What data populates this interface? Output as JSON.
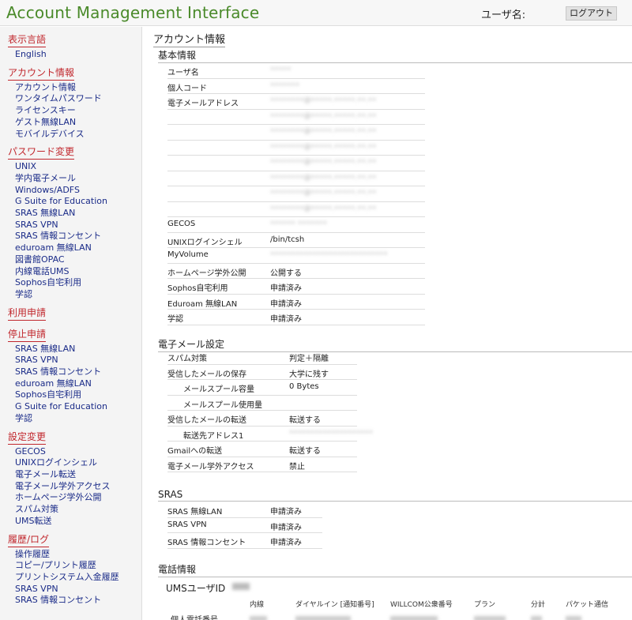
{
  "header": {
    "title": "Account Management Interface",
    "user_label": "ユーザ名:",
    "logout_label": "ログアウト"
  },
  "sidebar": {
    "sections": [
      {
        "heading": "表示言語",
        "items": [
          "English"
        ]
      },
      {
        "heading": "アカウント情報",
        "items": [
          "アカウント情報",
          "ワンタイムパスワード",
          "ライセンスキー",
          "ゲスト無線LAN",
          "モバイルデバイス"
        ]
      },
      {
        "heading": "パスワード変更",
        "items": [
          "UNIX",
          "学内電子メール",
          "Windows/ADFS",
          "G Suite for Education",
          "SRAS 無線LAN",
          "SRAS VPN",
          "SRAS 情報コンセント",
          "eduroam 無線LAN",
          "図書館OPAC",
          "内線電話UMS",
          "Sophos自宅利用",
          "学認"
        ]
      },
      {
        "heading": "利用申請",
        "items": []
      },
      {
        "heading": "停止申請",
        "items": [
          "SRAS 無線LAN",
          "SRAS VPN",
          "SRAS 情報コンセント",
          "eduroam 無線LAN",
          "Sophos自宅利用",
          "G Suite for Education",
          "学認"
        ]
      },
      {
        "heading": "設定変更",
        "items": [
          "GECOS",
          "UNIXログインシェル",
          "電子メール転送",
          "電子メール学外アクセス",
          "ホームページ学外公開",
          "スパム対策",
          "UMS転送"
        ]
      },
      {
        "heading": "履歴/ログ",
        "items": [
          "操作履歴",
          "コピー/プリント履歴",
          "プリントシステム入金履歴",
          "SRAS VPN",
          "SRAS 情報コンセント"
        ]
      }
    ]
  },
  "main": {
    "page_title": "アカウント情報",
    "basic": {
      "heading": "基本情報",
      "rows": [
        {
          "label": "ユーザ名",
          "value": "",
          "blur": "•••••"
        },
        {
          "label": "個人コード",
          "value": "",
          "blur": "•••••••"
        },
        {
          "label": "電子メールアドレス",
          "value": "",
          "blur": "••••••••@•••••.•••••.••.••"
        },
        {
          "label": "",
          "value": "",
          "blur": "••••••••@•••••.•••••.••.••"
        },
        {
          "label": "",
          "value": "",
          "blur": "••••••••@•••••.•••••.••.••"
        },
        {
          "label": "",
          "value": "",
          "blur": "••••••••@•••••.•••••.••.••"
        },
        {
          "label": "",
          "value": "",
          "blur": "••••••••@•••••.•••••.••.••"
        },
        {
          "label": "",
          "value": "",
          "blur": "••••••••@•••••.•••••.••.••"
        },
        {
          "label": "",
          "value": "",
          "blur": "••••••••@•••••.•••••.••.••"
        },
        {
          "label": "",
          "value": "",
          "blur": "••••••••@•••••.•••••.••.••"
        },
        {
          "label": "GECOS",
          "value": "",
          "blur": "•••••• •••••••"
        },
        {
          "label": "UNIXログインシェル",
          "value": "/bin/tcsh",
          "blur": ""
        },
        {
          "label": "MyVolume",
          "value": "",
          "blur": "••••••••••••••••••••••••••••"
        },
        {
          "label": "ホームページ学外公開",
          "value": "公開する",
          "blur": ""
        },
        {
          "label": "Sophos自宅利用",
          "value": "申請済み",
          "blur": ""
        },
        {
          "label": "Eduroam 無線LAN",
          "value": "申請済み",
          "blur": ""
        },
        {
          "label": "学認",
          "value": "申請済み",
          "blur": ""
        }
      ]
    },
    "email": {
      "heading": "電子メール設定",
      "rows": [
        {
          "label": "スパム対策",
          "value": "判定＋隔離",
          "indent": 0
        },
        {
          "label": "受信したメールの保存",
          "value": "大学に残す",
          "indent": 0
        },
        {
          "label": "メールスプール容量",
          "value": "0 Bytes",
          "indent": 1
        },
        {
          "label": "メールスプール使用量",
          "value": "",
          "indent": 1
        },
        {
          "label": "受信したメールの転送",
          "value": "転送する",
          "indent": 0
        },
        {
          "label": "転送先アドレス1",
          "value": "",
          "indent": 1,
          "blur": "••••••••••••••••••••"
        },
        {
          "label": "Gmailへの転送",
          "value": "転送する",
          "indent": 0
        },
        {
          "label": "電子メール学外アクセス",
          "value": "禁止",
          "indent": 0
        }
      ]
    },
    "sras": {
      "heading": "SRAS",
      "rows": [
        {
          "label": "SRAS 無線LAN",
          "value": "申請済み"
        },
        {
          "label": "SRAS VPN",
          "value": "申請済み"
        },
        {
          "label": "SRAS 情報コンセント",
          "value": "申請済み"
        }
      ]
    },
    "phone": {
      "heading": "電話情報",
      "ums_label": "UMSユーザID",
      "columns": [
        "内線",
        "ダイヤルイン [通知番号]",
        "WILLCOM公衆番号",
        "プラン",
        "分計",
        "パケット通信"
      ],
      "row_label": "個人電話番号"
    }
  }
}
